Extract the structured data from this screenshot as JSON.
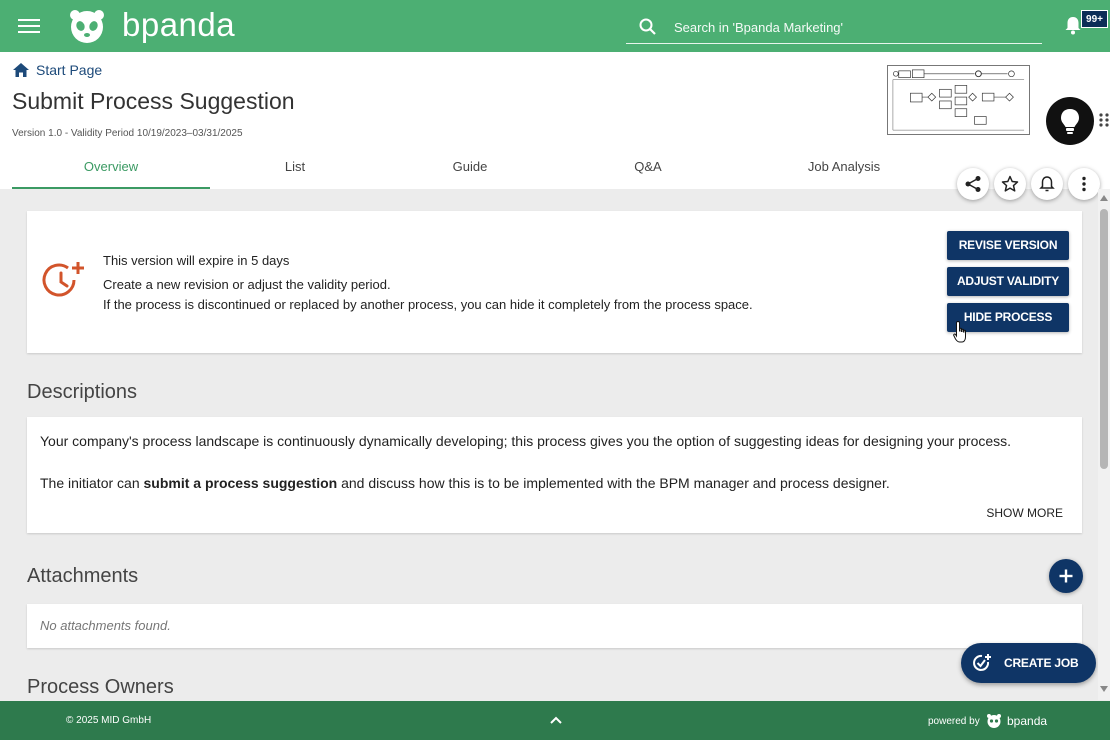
{
  "app": {
    "brand": "bpanda",
    "search_placeholder": "Search in 'Bpanda Marketing'",
    "notification_count": "99+"
  },
  "breadcrumb": {
    "label": "Start Page"
  },
  "page": {
    "title": "Submit Process Suggestion",
    "version_info": "Version 1.0 - Validity Period 10/19/2023–03/31/2025"
  },
  "tabs": [
    {
      "label": "Overview",
      "active": true
    },
    {
      "label": "List"
    },
    {
      "label": "Guide"
    },
    {
      "label": "Q&A"
    },
    {
      "label": "Job Analysis"
    }
  ],
  "header_actions": [
    "share-icon",
    "star-icon",
    "bell-icon",
    "more-vertical-icon"
  ],
  "expiry_notice": {
    "title": "This version will expire in 5 days",
    "line1": "Create a new revision or adjust the validity period.",
    "line2": "If the process is discontinued or replaced by another process, you can hide it completely from the process space.",
    "buttons": {
      "revise": "REVISE VERSION",
      "adjust": "ADJUST VALIDITY",
      "hide": "HIDE PROCESS"
    }
  },
  "descriptions": {
    "heading": "Descriptions",
    "paragraph1": "Your company's process landscape is continuously dynamically developing; this process gives you the option of suggesting ideas for designing your process.",
    "paragraph2_before": "The initiator can ",
    "paragraph2_bold": "submit a process suggestion",
    "paragraph2_after": " and discuss how this is to be implemented with the BPM manager and process designer.",
    "show_more": "SHOW MORE"
  },
  "attachments": {
    "heading": "Attachments",
    "empty_text": "No attachments found."
  },
  "process_owners": {
    "heading": "Process Owners"
  },
  "create_job": {
    "label": "CREATE JOB"
  },
  "footer": {
    "copyright": "© 2025 MID GmbH",
    "powered_by": "powered by",
    "brand": "bpanda"
  },
  "colors": {
    "topbar": "#4caf73",
    "footer": "#2e7a4d",
    "primary_button": "#0f3566",
    "active_tab": "#3b9a63",
    "warning_icon": "#d2542b"
  }
}
